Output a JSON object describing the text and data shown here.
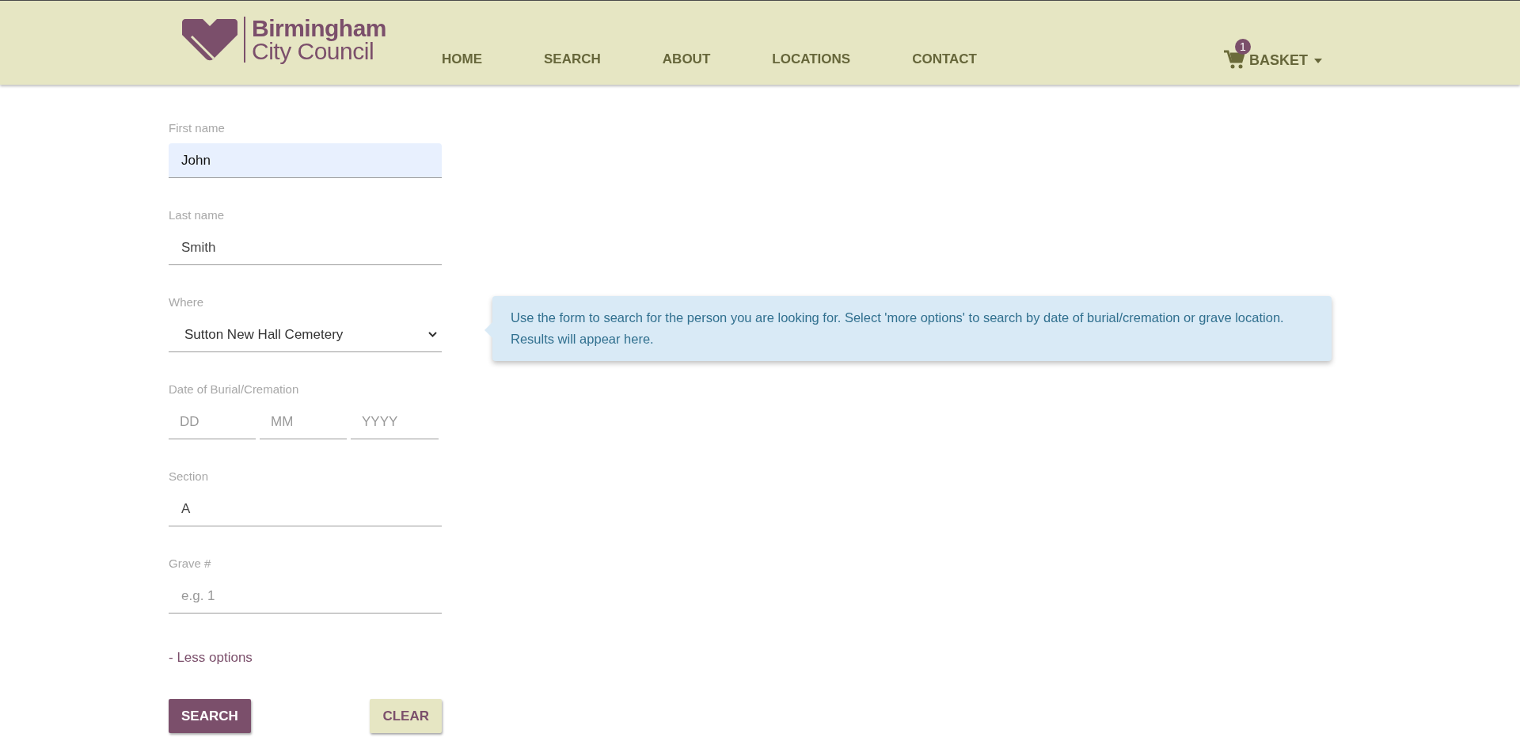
{
  "header": {
    "logo": {
      "line_1": "Birmingham",
      "line_2": "City Council"
    },
    "nav": [
      {
        "label": "HOME"
      },
      {
        "label": "SEARCH"
      },
      {
        "label": "ABOUT"
      },
      {
        "label": "LOCATIONS"
      },
      {
        "label": "CONTACT"
      }
    ],
    "basket": {
      "label": "BASKET",
      "count": "1"
    }
  },
  "form": {
    "fields": [
      {
        "kind": "text",
        "label": "First name",
        "value": "John",
        "autofilled": true
      },
      {
        "kind": "text",
        "label": "Last name",
        "value": "Smith",
        "autofilled": false
      },
      {
        "kind": "select",
        "label": "Where",
        "value": "Sutton New Hall Cemetery"
      },
      {
        "kind": "date",
        "label": "Date of Burial/Cremation",
        "parts": [
          {
            "placeholder": "DD"
          },
          {
            "placeholder": "MM"
          },
          {
            "placeholder": "YYYY"
          }
        ]
      },
      {
        "kind": "text",
        "label": "Section",
        "value": "A",
        "autofilled": false
      },
      {
        "kind": "text",
        "label": "Grave #",
        "placeholder": "e.g. 1",
        "autofilled": false
      }
    ],
    "toggle_link": "- Less options",
    "buttons": [
      {
        "kind": "primary",
        "label": "SEARCH"
      },
      {
        "kind": "secondary",
        "label": "CLEAR"
      }
    ]
  },
  "info_message": "Use the form to search for the person you are looking for. Select 'more options' to search by date of burial/cremation or grave location. Results will appear here."
}
